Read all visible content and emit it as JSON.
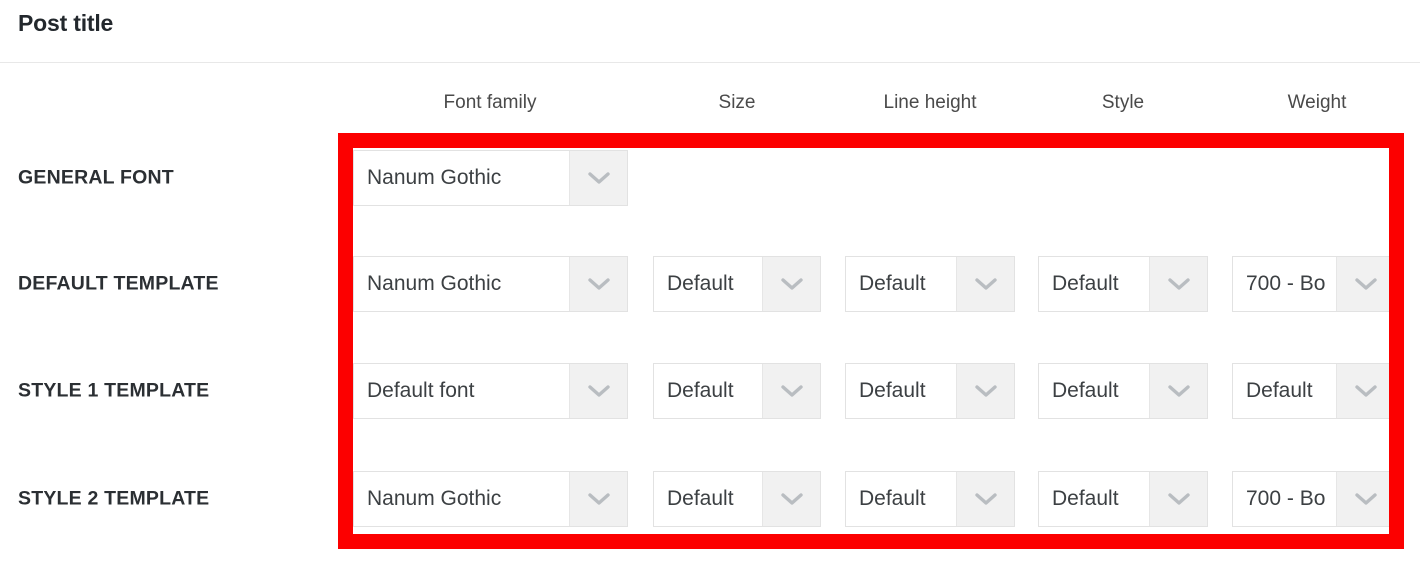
{
  "header": {
    "title": "Post title"
  },
  "table": {
    "columns": [
      {
        "key": "family",
        "label": "Font family"
      },
      {
        "key": "size",
        "label": "Size"
      },
      {
        "key": "lineheight",
        "label": "Line height"
      },
      {
        "key": "style",
        "label": "Style"
      },
      {
        "key": "weight",
        "label": "Weight"
      }
    ],
    "rows": [
      {
        "label": "GENERAL FONT",
        "family": "Nanum Gothic",
        "size": null,
        "lineheight": null,
        "style": null,
        "weight": null
      },
      {
        "label": "DEFAULT TEMPLATE",
        "family": "Nanum Gothic",
        "size": "Default",
        "lineheight": "Default",
        "style": "Default",
        "weight": "700 - Bo"
      },
      {
        "label": "STYLE 1 TEMPLATE",
        "family": "Default font",
        "size": "Default",
        "lineheight": "Default",
        "style": "Default",
        "weight": "Default"
      },
      {
        "label": "STYLE 2 TEMPLATE",
        "family": "Nanum Gothic",
        "size": "Default",
        "lineheight": "Default",
        "style": "Default",
        "weight": "700 - Bo"
      }
    ]
  },
  "annotation": {
    "highlight_color": "#fc0000",
    "shape": "rectangle-outline"
  },
  "icons": {
    "dropdown_arrow": "chevron-down-icon"
  }
}
